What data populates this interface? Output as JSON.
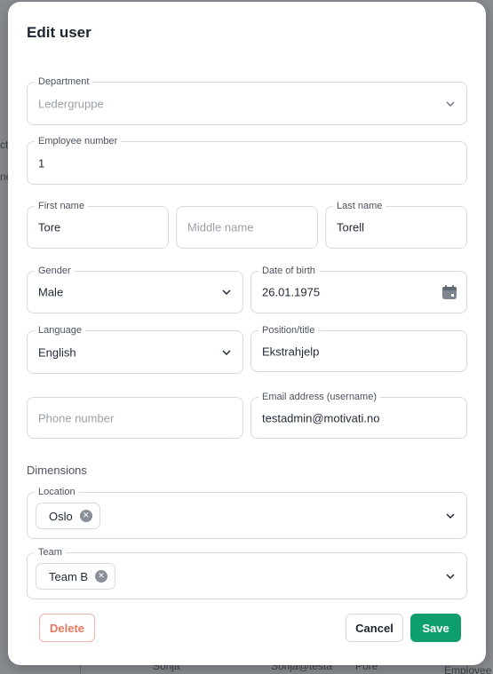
{
  "background": {
    "fragments": [
      "cto",
      "ner",
      "Sonja",
      "Sonja@testa",
      "Pore",
      "Employee"
    ]
  },
  "modal": {
    "title": "Edit user",
    "fields": {
      "department": {
        "label": "Department",
        "value": "Ledergruppe"
      },
      "employee_number": {
        "label": "Employee number",
        "value": "1"
      },
      "first_name": {
        "label": "First name",
        "value": "Tore"
      },
      "middle_name": {
        "placeholder": "Middle name"
      },
      "last_name": {
        "label": "Last name",
        "value": "Torell"
      },
      "gender": {
        "label": "Gender",
        "value": "Male"
      },
      "date_of_birth": {
        "label": "Date of birth",
        "value": "26.01.1975"
      },
      "language": {
        "label": "Language",
        "value": "English"
      },
      "position": {
        "label": "Position/title",
        "value": "Ekstrahjelp"
      },
      "phone": {
        "placeholder": "Phone number"
      },
      "email": {
        "label": "Email address (username)",
        "value": "testadmin@motivati.no"
      }
    },
    "dimensions": {
      "heading": "Dimensions",
      "location": {
        "label": "Location",
        "chips": [
          "Oslo"
        ]
      },
      "team": {
        "label": "Team",
        "chips": [
          "Team B"
        ]
      }
    },
    "buttons": {
      "delete": "Delete",
      "cancel": "Cancel",
      "save": "Save"
    }
  },
  "colors": {
    "accent": "#0f9f6e",
    "danger": "#e8775f",
    "border": "#d6dae0"
  }
}
